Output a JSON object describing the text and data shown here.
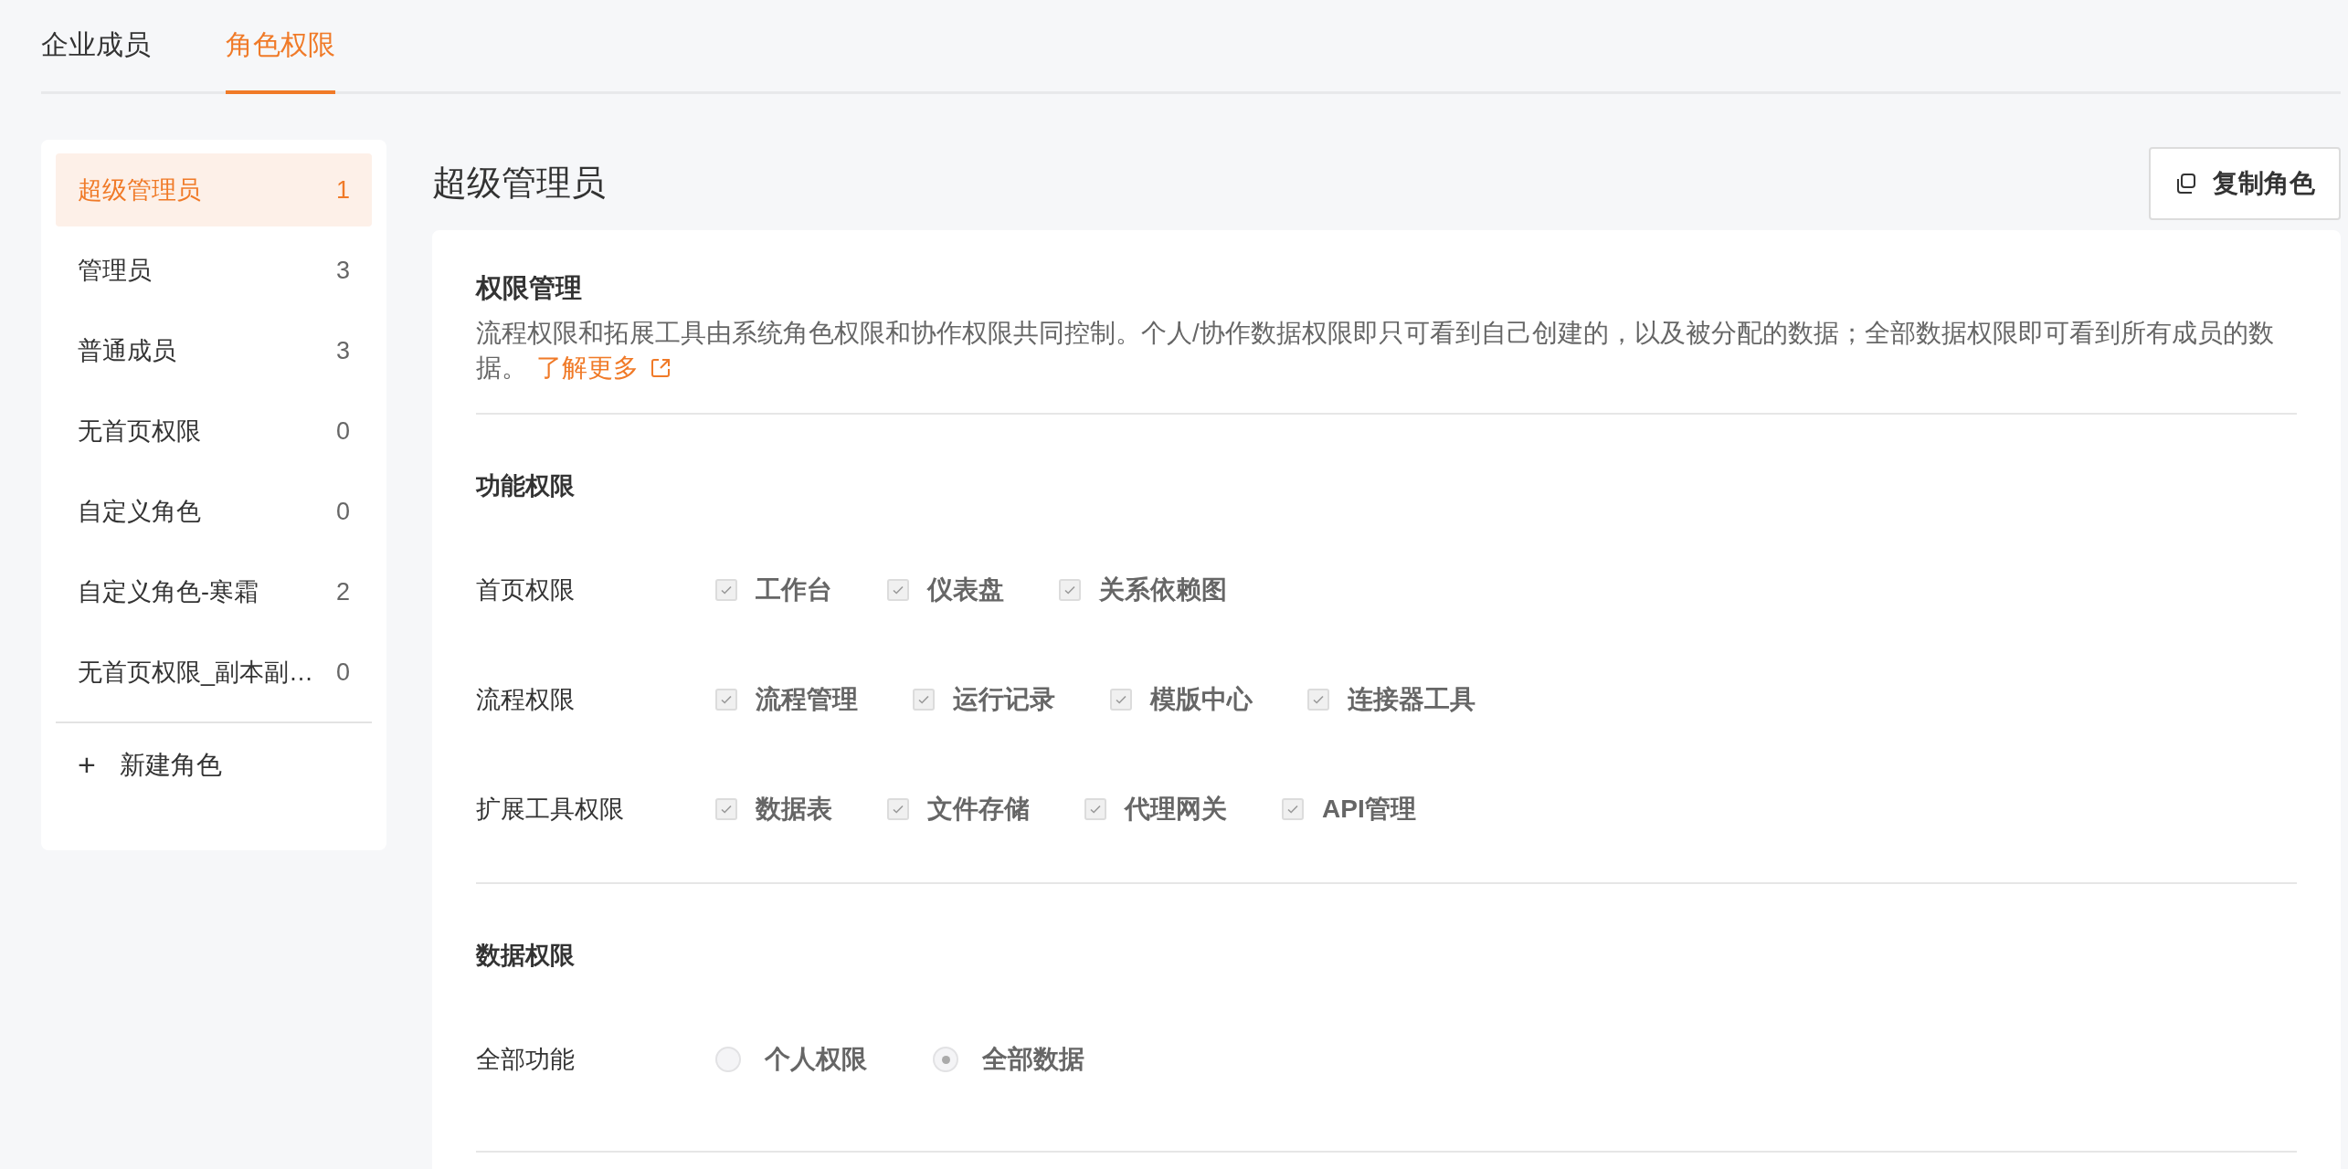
{
  "tabs": [
    {
      "label": "企业成员",
      "selected": false
    },
    {
      "label": "角色权限",
      "selected": true
    }
  ],
  "roles": [
    {
      "name": "超级管理员",
      "count": "1",
      "selected": true
    },
    {
      "name": "管理员",
      "count": "3",
      "selected": false
    },
    {
      "name": "普通成员",
      "count": "3",
      "selected": false
    },
    {
      "name": "无首页权限",
      "count": "0",
      "selected": false
    },
    {
      "name": "自定义角色",
      "count": "0",
      "selected": false
    },
    {
      "name": "自定义角色-寒霜",
      "count": "2",
      "selected": false
    },
    {
      "name": "无首页权限_副本副…",
      "count": "0",
      "selected": false
    }
  ],
  "new_role": {
    "icon": "+",
    "label": "新建角色"
  },
  "title": "超级管理员",
  "copy_button": "复制角色",
  "permissions": {
    "title": "权限管理",
    "description": "流程权限和拓展工具由系统角色权限和协作权限共同控制。个人/协作数据权限即只可看到自己创建的，以及被分配的数据；全部数据权限即可看到所有成员的数据。",
    "link": "了解更多"
  },
  "function_section": {
    "title": "功能权限",
    "rows": [
      {
        "label": "首页权限",
        "options": [
          {
            "label": "工作台",
            "checked": true,
            "disabled": true
          },
          {
            "label": "仪表盘",
            "checked": true,
            "disabled": true
          },
          {
            "label": "关系依赖图",
            "checked": true,
            "disabled": true
          }
        ]
      },
      {
        "label": "流程权限",
        "options": [
          {
            "label": "流程管理",
            "checked": true,
            "disabled": true
          },
          {
            "label": "运行记录",
            "checked": true,
            "disabled": true
          },
          {
            "label": "模版中心",
            "checked": true,
            "disabled": true
          },
          {
            "label": "连接器工具",
            "checked": true,
            "disabled": true
          }
        ]
      },
      {
        "label": "扩展工具权限",
        "options": [
          {
            "label": "数据表",
            "checked": true,
            "disabled": true
          },
          {
            "label": "文件存储",
            "checked": true,
            "disabled": true
          },
          {
            "label": "代理网关",
            "checked": true,
            "disabled": true
          },
          {
            "label": "API管理",
            "checked": true,
            "disabled": true
          }
        ]
      }
    ]
  },
  "data_section": {
    "title": "数据权限",
    "rows": [
      {
        "label": "全部功能",
        "options": [
          {
            "label": "个人权限",
            "selected": false,
            "disabled": true
          },
          {
            "label": "全部数据",
            "selected": true,
            "disabled": true
          }
        ]
      }
    ]
  }
}
